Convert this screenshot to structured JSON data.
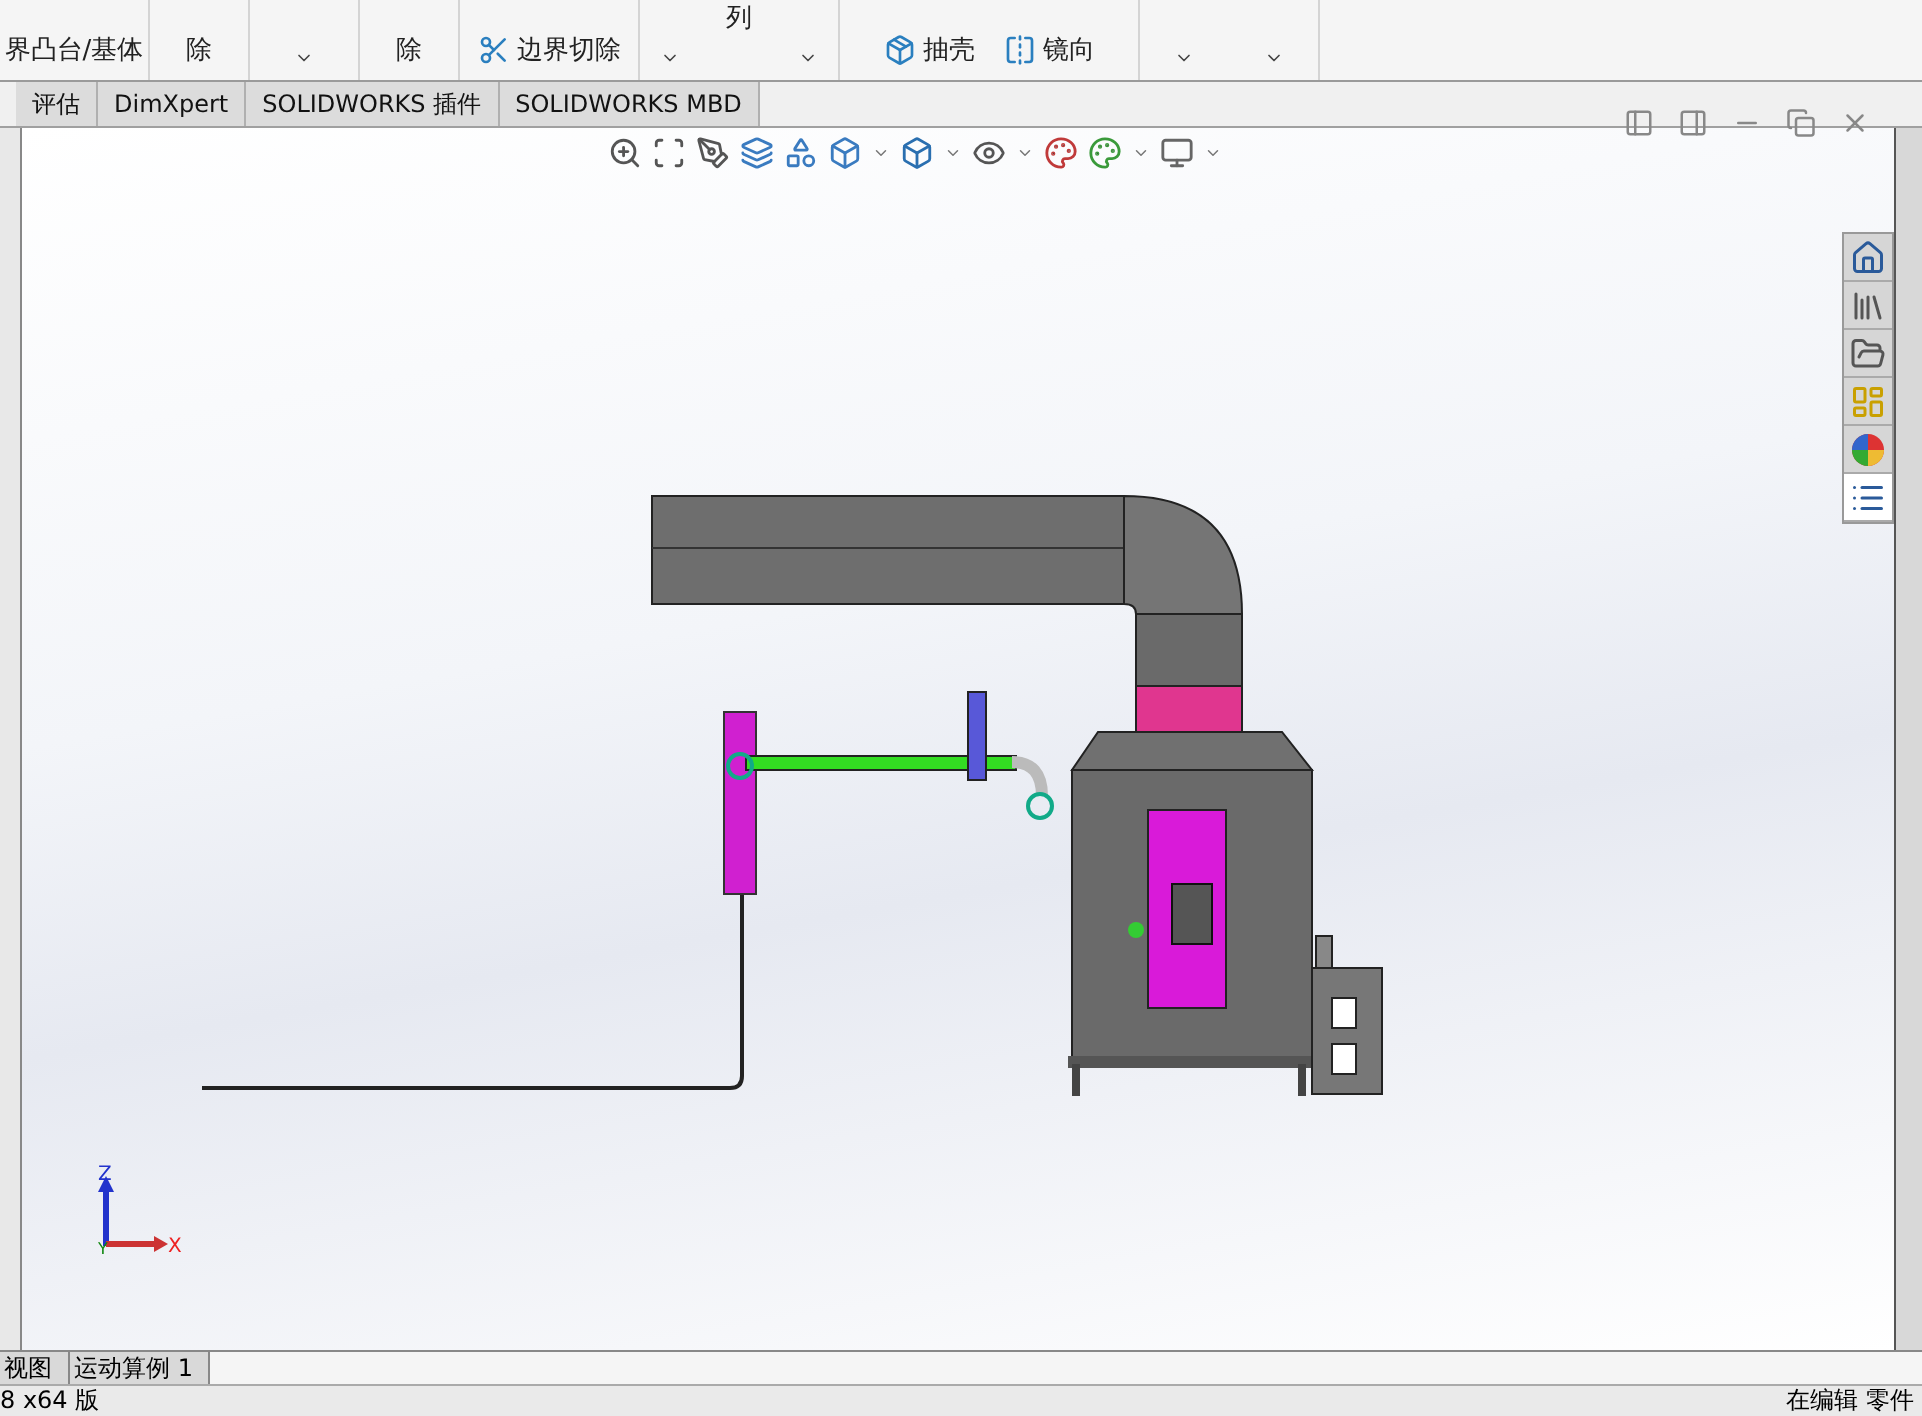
{
  "ribbon": {
    "groups": [
      {
        "kind": "stack",
        "items": [
          "界凸台/基体"
        ]
      },
      {
        "kind": "stack",
        "items": [
          "除"
        ]
      },
      {
        "kind": "caret"
      },
      {
        "kind": "stack",
        "items": [
          "除"
        ]
      },
      {
        "kind": "tools",
        "items": [
          "边界切除"
        ]
      },
      {
        "kind": "caret2",
        "items": [
          "列"
        ]
      },
      {
        "kind": "tools",
        "items": [
          "抽壳",
          "镜向"
        ]
      },
      {
        "kind": "caret2"
      }
    ]
  },
  "tabs": [
    {
      "label": "评估",
      "selected": false
    },
    {
      "label": "DimXpert",
      "selected": false
    },
    {
      "label": "SOLIDWORKS 插件",
      "selected": false
    },
    {
      "label": "SOLIDWORKS MBD",
      "selected": false
    }
  ],
  "triad": {
    "z": "Z",
    "x": "X",
    "y": "Y"
  },
  "bottom_tabs": [
    {
      "label": "视图",
      "selected": false
    },
    {
      "label": "运动算例 1",
      "selected": false
    }
  ],
  "status_bar": {
    "left": "8 x64 版",
    "right": "在编辑 零件"
  }
}
